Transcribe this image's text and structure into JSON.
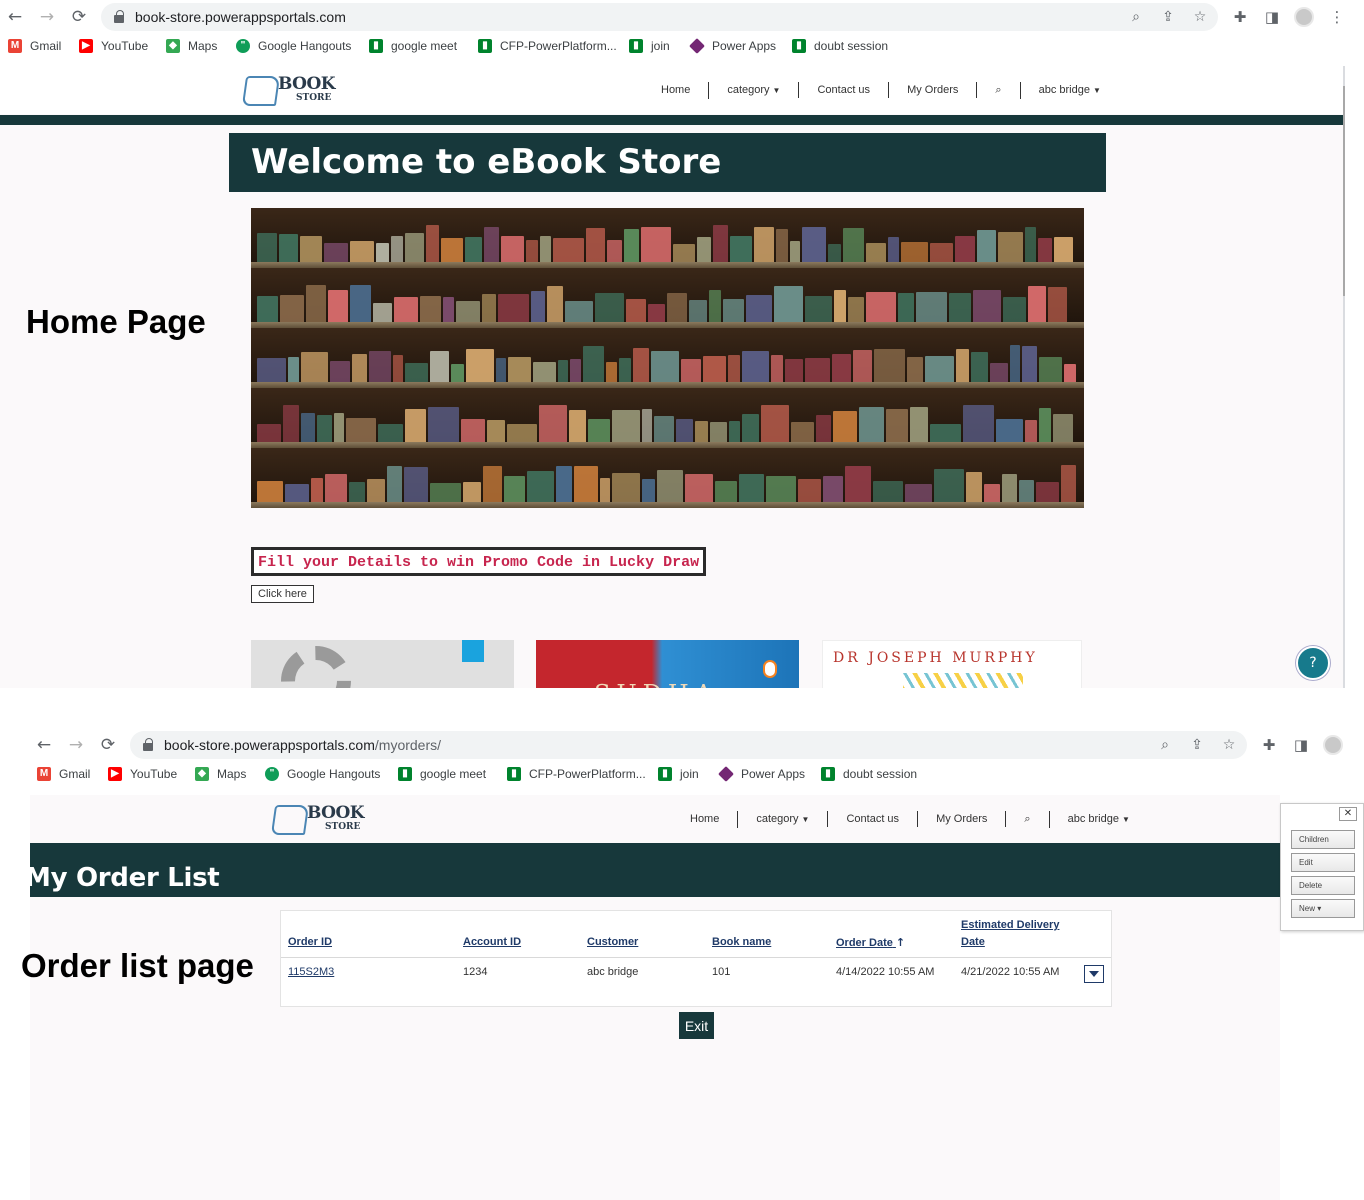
{
  "browser1": {
    "url": "book-store.powerappsportals.com",
    "url_path": ""
  },
  "browser2": {
    "url": "book-store.powerappsportals.com",
    "url_path": "/myorders/"
  },
  "bookmarks": [
    {
      "label": "Gmail",
      "icon": "gmail-icon",
      "color": "#ea4335"
    },
    {
      "label": "YouTube",
      "icon": "youtube-icon",
      "color": "#ff0000"
    },
    {
      "label": "Maps",
      "icon": "maps-icon",
      "color": "#34a853"
    },
    {
      "label": "Google Hangouts",
      "icon": "hangouts-icon",
      "color": "#0f9d58"
    },
    {
      "label": "google meet",
      "icon": "meet-icon",
      "color": "#00832d"
    },
    {
      "label": "CFP-PowerPlatform...",
      "icon": "meet-icon",
      "color": "#00832d"
    },
    {
      "label": "join",
      "icon": "meet-icon",
      "color": "#00832d"
    },
    {
      "label": "Power Apps",
      "icon": "powerapps-icon",
      "color": "#742774"
    },
    {
      "label": "doubt session",
      "icon": "meet-icon",
      "color": "#00832d"
    }
  ],
  "site": {
    "logo_line1": "BOOK",
    "logo_line2": "STORE",
    "menu": {
      "home": "Home",
      "category": "category",
      "contact": "Contact us",
      "orders": "My Orders",
      "user": "abc bridge"
    },
    "brand_color": "#17383b"
  },
  "home": {
    "welcome": "Welcome to eBook Store",
    "promo": "Fill your Details to win Promo Code in Lucky Draw",
    "click_here": "Click here",
    "thumb3_text": "DR JOSEPH MURPHY",
    "thumb2_text": "SUDHA"
  },
  "labels": {
    "home_page": "Home Page",
    "order_list_page": "Order list page"
  },
  "orders": {
    "title": "My Order List",
    "columns": [
      "Order ID",
      "Account ID",
      "Customer",
      "Book name",
      "Order Date",
      "Estimated Delivery Date"
    ],
    "rows": [
      {
        "order_id": "115S2M3",
        "account_id": "1234",
        "customer": "abc bridge",
        "book_name": "101",
        "order_date": "4/14/2022 10:55 AM",
        "delivery_date": "4/21/2022 10:55 AM"
      }
    ],
    "exit": "Exit"
  },
  "side_panel": {
    "close": "✕",
    "children": "Children",
    "edit": "Edit",
    "delete": "Delete",
    "new": "New"
  }
}
